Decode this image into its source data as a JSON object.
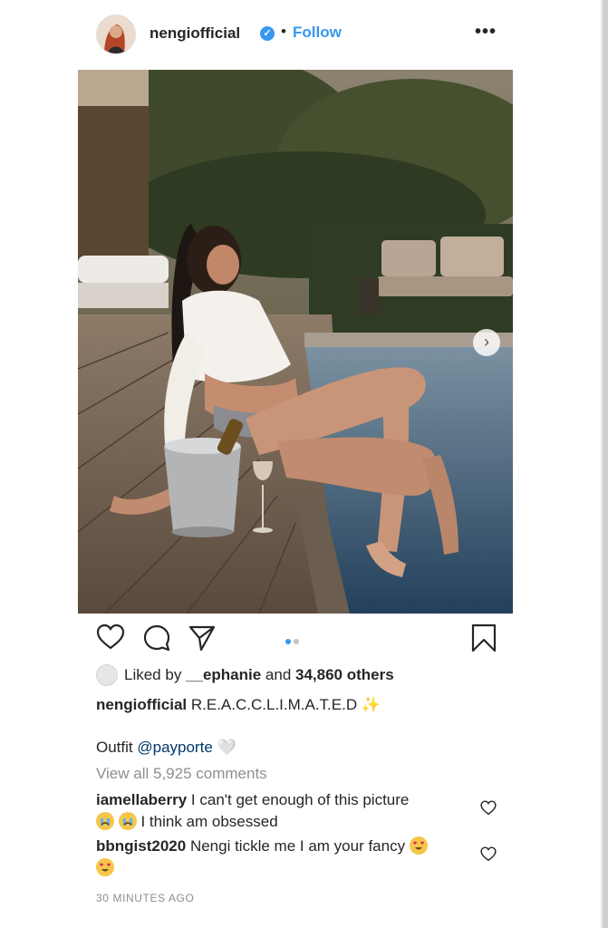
{
  "post": {
    "username": "nengiofficial",
    "separator": "•",
    "follow_label": "Follow",
    "more_label": "•••"
  },
  "photo": {
    "alt": "Woman in white crop top seated at the edge of a pool next to a champagne bucket",
    "pages": 2,
    "current_page": 1
  },
  "likes": {
    "prefix": "Liked by ",
    "user": "__ephanie",
    "middle": " and ",
    "count": "34,860 others"
  },
  "caption": {
    "username": "nengiofficial",
    "text": "R.E.A.C.C.L.I.M.A.T.E.D",
    "emoji": "✨"
  },
  "outfit": {
    "text": "Outfit ",
    "mention": "@payporte",
    "emoji": "🤍"
  },
  "view_all": "View all 5,925 comments",
  "comments": [
    {
      "username": "iamellaberry",
      "text1": "I can't get enough of this picture",
      "text2": "I think am obsessed"
    },
    {
      "username": "bbngist2020",
      "text1": "Nengi tickle me I am your fancy"
    }
  ],
  "timestamp": "30 MINUTES AGO",
  "colors": {
    "accent": "#3897f0",
    "text": "#262626",
    "muted": "#8e8e8e"
  }
}
